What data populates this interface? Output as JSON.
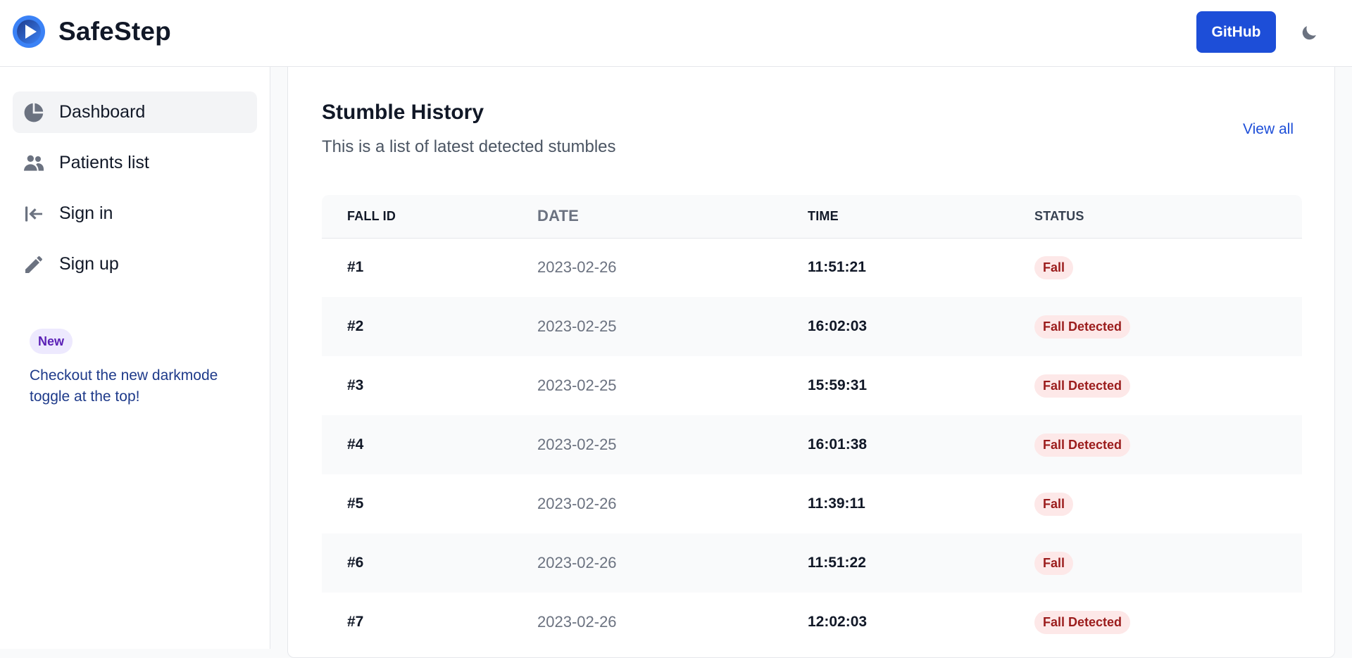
{
  "app": {
    "name": "SafeStep",
    "github_label": "GitHub"
  },
  "colors": {
    "primary": "#1d4ed8",
    "badge_bg": "#fde8e8",
    "badge_text": "#9b1c1c",
    "promo_bg": "#ede9fe",
    "promo_text": "#5b21b6"
  },
  "sidebar": {
    "items": [
      {
        "label": "Dashboard",
        "icon": "chart-pie-icon",
        "active": true
      },
      {
        "label": "Patients list",
        "icon": "users-icon",
        "active": false
      },
      {
        "label": "Sign in",
        "icon": "arrow-left-to-bar-icon",
        "active": false
      },
      {
        "label": "Sign up",
        "icon": "pencil-icon",
        "active": false
      }
    ],
    "promo": {
      "badge": "New",
      "text": "Checkout the new darkmode toggle at the top!"
    }
  },
  "main": {
    "title": "Stumble History",
    "subtitle": "This is a list of latest detected stumbles",
    "view_all": "View all",
    "table": {
      "headers": [
        "FALL ID",
        "DATE",
        "TIME",
        "STATUS"
      ],
      "rows": [
        {
          "id": "#1",
          "date": "2023-02-26",
          "time": "11:51:21",
          "status": "Fall"
        },
        {
          "id": "#2",
          "date": "2023-02-25",
          "time": "16:02:03",
          "status": "Fall Detected"
        },
        {
          "id": "#3",
          "date": "2023-02-25",
          "time": "15:59:31",
          "status": "Fall Detected"
        },
        {
          "id": "#4",
          "date": "2023-02-25",
          "time": "16:01:38",
          "status": "Fall Detected"
        },
        {
          "id": "#5",
          "date": "2023-02-26",
          "time": "11:39:11",
          "status": "Fall"
        },
        {
          "id": "#6",
          "date": "2023-02-26",
          "time": "11:51:22",
          "status": "Fall"
        },
        {
          "id": "#7",
          "date": "2023-02-26",
          "time": "12:02:03",
          "status": "Fall Detected"
        }
      ]
    }
  }
}
